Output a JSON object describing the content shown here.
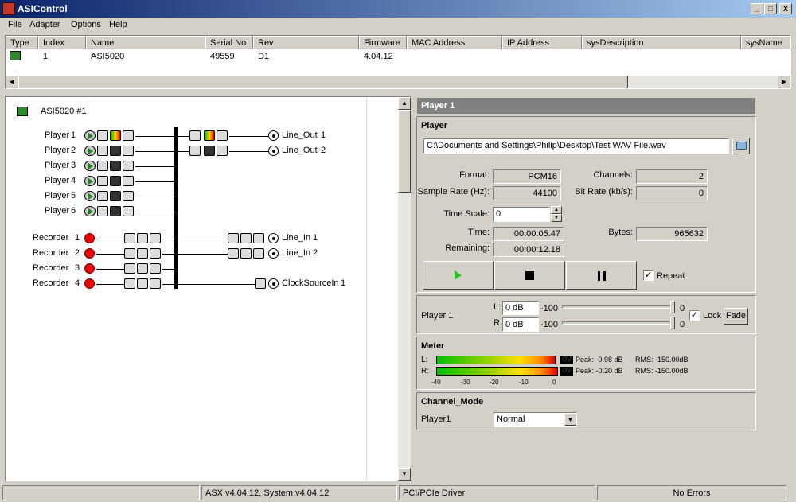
{
  "window": {
    "title": "ASIControl",
    "minimize": "_",
    "maximize": "□",
    "close": "X"
  },
  "menu": [
    "File",
    "Adapter",
    "Options",
    "Help"
  ],
  "adapter_table": {
    "columns": [
      "Type",
      "Index",
      "Name",
      "Serial No.",
      "Rev",
      "Firmware",
      "MAC Address",
      "IP Address",
      "sysDescription",
      "sysName"
    ],
    "row": {
      "index": "1",
      "name": "ASI5020",
      "serial": "49559",
      "rev": "D1",
      "firmware": "4.04.12"
    }
  },
  "topology": {
    "adapter_label": "ASI5020 #1",
    "players": [
      {
        "name": "Player",
        "num": "1"
      },
      {
        "name": "Player",
        "num": "2"
      },
      {
        "name": "Player",
        "num": "3"
      },
      {
        "name": "Player",
        "num": "4"
      },
      {
        "name": "Player",
        "num": "5"
      },
      {
        "name": "Player",
        "num": "6"
      }
    ],
    "recorders": [
      {
        "name": "Recorder",
        "num": "1"
      },
      {
        "name": "Recorder",
        "num": "2"
      },
      {
        "name": "Recorder",
        "num": "3"
      },
      {
        "name": "Recorder",
        "num": "4"
      }
    ],
    "line_outs": [
      {
        "name": "Line_Out",
        "num": "1"
      },
      {
        "name": "Line_Out",
        "num": "2"
      }
    ],
    "line_ins": [
      {
        "name": "Line_In",
        "num": "1"
      },
      {
        "name": "Line_In",
        "num": "2"
      }
    ],
    "clock": {
      "name": "ClockSourceIn",
      "num": "1"
    }
  },
  "player_panel": {
    "header": "Player  1",
    "section_title": "Player",
    "file_path": "C:\\Documents and Settings\\Philip\\Desktop\\Test WAV File.wav",
    "format_label": "Format:",
    "format": "PCM16",
    "channels_label": "Channels:",
    "channels": "2",
    "sample_rate_label": "Sample Rate (Hz):",
    "sample_rate": "44100",
    "bit_rate_label": "Bit Rate (kb/s):",
    "bit_rate": "0",
    "time_scale_label": "Time Scale:",
    "time_scale": "0",
    "time_label": "Time:",
    "time": "00:00:05.47",
    "bytes_label": "Bytes:",
    "bytes": "965632",
    "remaining_label": "Remaining:",
    "remaining": "00:00:12.18",
    "repeat_label": "Repeat",
    "repeat_checked": true
  },
  "volume": {
    "label": "Player  1",
    "l_label": "L:",
    "l_value": "0 dB",
    "l_min": "-100",
    "l_max": "0",
    "r_label": "R:",
    "r_value": "0 dB",
    "r_min": "-100",
    "r_max": "0",
    "lock_label": "Lock",
    "lock_checked": true,
    "fade_label": "Fade"
  },
  "meter": {
    "title": "Meter",
    "l_label": "L:",
    "r_label": "R:",
    "ovr_label": "OV",
    "l_peak": "Peak: -0.98 dB",
    "l_rms": "RMS: -150.00dB",
    "r_peak": "Peak: -0.20 dB",
    "r_rms": "RMS: -150.00dB",
    "l_level_db": -0.98,
    "r_level_db": -0.2,
    "scale": [
      "-40",
      "-30",
      "-20",
      "-10",
      "0"
    ]
  },
  "channel_mode": {
    "title": "Channel_Mode",
    "label": "Player1",
    "value": "Normal"
  },
  "status": {
    "versions": "ASX v4.04.12, System v4.04.12",
    "driver": "PCI/PCIe Driver",
    "errors": "No Errors"
  }
}
